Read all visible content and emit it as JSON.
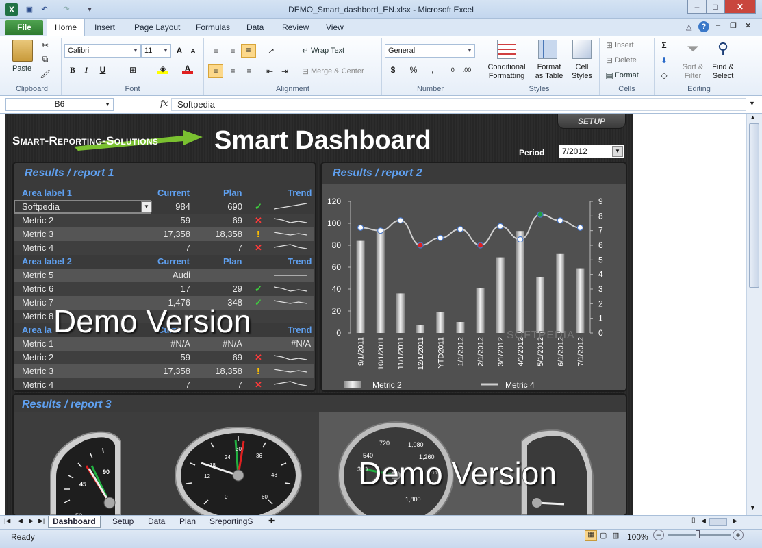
{
  "window": {
    "title": "DEMO_Smart_dashbord_EN.xlsx  -  Microsoft Excel"
  },
  "ribbon_tabs": [
    "File",
    "Home",
    "Insert",
    "Page Layout",
    "Formulas",
    "Data",
    "Review",
    "View"
  ],
  "ribbon": {
    "clipboard": {
      "paste": "Paste",
      "label": "Clipboard"
    },
    "font": {
      "name": "Calibri",
      "size": "11",
      "label": "Font",
      "bold": "B",
      "italic": "I",
      "underline": "U"
    },
    "alignment": {
      "wrap": "Wrap Text",
      "merge": "Merge & Center",
      "label": "Alignment"
    },
    "number": {
      "format": "General",
      "dollar": "$",
      "percent": "%",
      "comma": ",",
      "label": "Number"
    },
    "styles": {
      "cond1": "Conditional",
      "cond2": "Formatting",
      "fmt1": "Format",
      "fmt2": "as Table",
      "cell1": "Cell",
      "cell2": "Styles",
      "label": "Styles"
    },
    "cells": {
      "insert": "Insert",
      "delete": "Delete",
      "format": "Format",
      "label": "Cells"
    },
    "editing": {
      "sort1": "Sort &",
      "sort2": "Filter",
      "find1": "Find &",
      "find2": "Select",
      "label": "Editing"
    }
  },
  "formula_bar": {
    "name_box": "B6",
    "fx": "fx",
    "value": "Softpedia"
  },
  "dashboard": {
    "brand": "Smart-Reporting-Solutions",
    "title": "Smart Dashboard",
    "setup": "SETUP",
    "period_label": "Period",
    "period_value": "7/2012",
    "report1": {
      "title": "Results / report  1",
      "sections": [
        {
          "label": "Area label 1",
          "current": "Current",
          "plan": "Plan",
          "trend": "Trend",
          "rows": [
            {
              "name": "Softpedia",
              "current": "984",
              "plan": "690",
              "status": "ok"
            },
            {
              "name": "Metric 2",
              "current": "59",
              "plan": "69",
              "status": "bad"
            },
            {
              "name": "Metric 3",
              "current": "17,358",
              "plan": "18,358",
              "status": "warn"
            },
            {
              "name": "Metric 4",
              "current": "7",
              "plan": "7",
              "status": "bad"
            }
          ]
        },
        {
          "label": "Area label 2",
          "current": "Current",
          "plan": "Plan",
          "trend": "Trend",
          "rows": [
            {
              "name": "Metric 5",
              "current": "Audi",
              "plan": "",
              "status": ""
            },
            {
              "name": "Metric 6",
              "current": "17",
              "plan": "29",
              "status": "ok"
            },
            {
              "name": "Metric 7",
              "current": "1,476",
              "plan": "348",
              "status": "ok"
            },
            {
              "name": "Metric 8",
              "current": "",
              "plan": "",
              "status": ""
            }
          ]
        },
        {
          "label": "Area la",
          "current": "Curre",
          "plan": "",
          "trend": "Trend",
          "rows": [
            {
              "name": "Metric 1",
              "current": "#N/A",
              "plan": "#N/A",
              "trend": "#N/A",
              "status": ""
            },
            {
              "name": "Metric 2",
              "current": "59",
              "plan": "69",
              "status": "bad"
            },
            {
              "name": "Metric 3",
              "current": "17,358",
              "plan": "18,358",
              "status": "warn"
            },
            {
              "name": "Metric 4",
              "current": "7",
              "plan": "7",
              "status": "bad"
            }
          ]
        }
      ],
      "demo": "Demo Version"
    },
    "report2": {
      "title": "Results / report  2"
    },
    "report3": {
      "title": "Results / report  3",
      "demo": "Demo Version",
      "gauge1": {
        "ticks": [
          "45",
          "90"
        ],
        "bottom": "50"
      },
      "gauge2": {
        "ticks": [
          "30",
          "36",
          "48",
          "60",
          "0",
          "12",
          "24",
          "18"
        ]
      },
      "gauge3": {
        "ticks": [
          "720",
          "1,080",
          "1,260",
          "1,440",
          "1,800",
          "540",
          "360"
        ]
      }
    }
  },
  "chart_data": {
    "type": "bar",
    "categories": [
      "9/1/2011",
      "10/1/2011",
      "11/1/2011",
      "12/1/2011",
      "YTD2011",
      "1/1/2012",
      "2/1/2012",
      "3/1/2012",
      "4/1/2012",
      "5/1/2012",
      "6/1/2012",
      "7/1/2012"
    ],
    "series": [
      {
        "name": "Metric 2",
        "type": "bar",
        "axis": "left",
        "values": [
          84,
          95,
          36,
          7,
          19,
          10,
          41,
          69,
          93,
          51,
          72,
          59
        ]
      },
      {
        "name": "Metric 4",
        "type": "line",
        "axis": "right",
        "values": [
          7.2,
          7.0,
          7.7,
          6.0,
          6.5,
          7.1,
          6.0,
          7.3,
          6.4,
          8.1,
          7.7,
          7.2
        ],
        "marker_colors": [
          "#ffffff",
          "#ffffff",
          "#ffffff",
          "#e02020",
          "#ffffff",
          "#ffffff",
          "#e02020",
          "#ffffff",
          "#ffffff",
          "#20a040",
          "#ffffff",
          "#ffffff"
        ]
      }
    ],
    "y_left": {
      "ticks": [
        "0",
        "20",
        "40",
        "60",
        "80",
        "100",
        "120"
      ],
      "lim": [
        0,
        120
      ]
    },
    "y_right": {
      "ticks": [
        "0",
        "1",
        "2",
        "3",
        "4",
        "5",
        "6",
        "7",
        "8",
        "9"
      ],
      "lim": [
        0,
        9
      ]
    },
    "legend": [
      "Metric 2",
      "Metric 4"
    ],
    "watermark": "SOFTPEDIA"
  },
  "sheet_tabs": [
    "Dashboard",
    "Setup",
    "Data",
    "Plan",
    "SreportingS"
  ],
  "status": {
    "ready": "Ready",
    "zoom": "100%"
  }
}
